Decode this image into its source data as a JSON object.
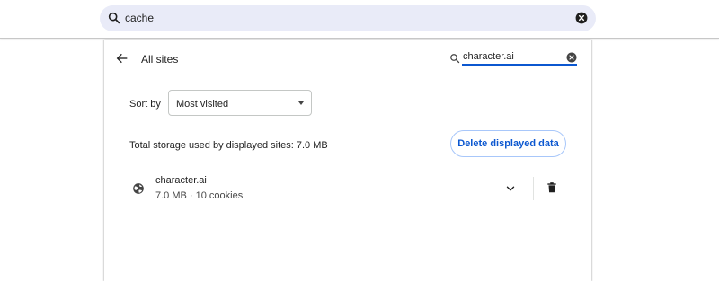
{
  "settings_search": {
    "value": "cache",
    "icon": "search-icon",
    "clear_icon": "clear-icon"
  },
  "header": {
    "title": "All sites",
    "back_icon": "back-arrow-icon"
  },
  "site_filter": {
    "value": "character.ai",
    "icon": "search-icon",
    "clear_icon": "clear-icon"
  },
  "sort": {
    "label": "Sort by",
    "selected": "Most visited"
  },
  "storage": {
    "summary": "Total storage used by displayed sites: 7.0 MB",
    "delete_button": "Delete displayed data"
  },
  "sites": [
    {
      "name": "character.ai",
      "details": "7.0 MB · 10 cookies",
      "icon": "globe-icon"
    }
  ],
  "colors": {
    "accent": "#0b57d0",
    "search_bg": "#e9ebf8",
    "button_border": "#a8c7fa"
  }
}
